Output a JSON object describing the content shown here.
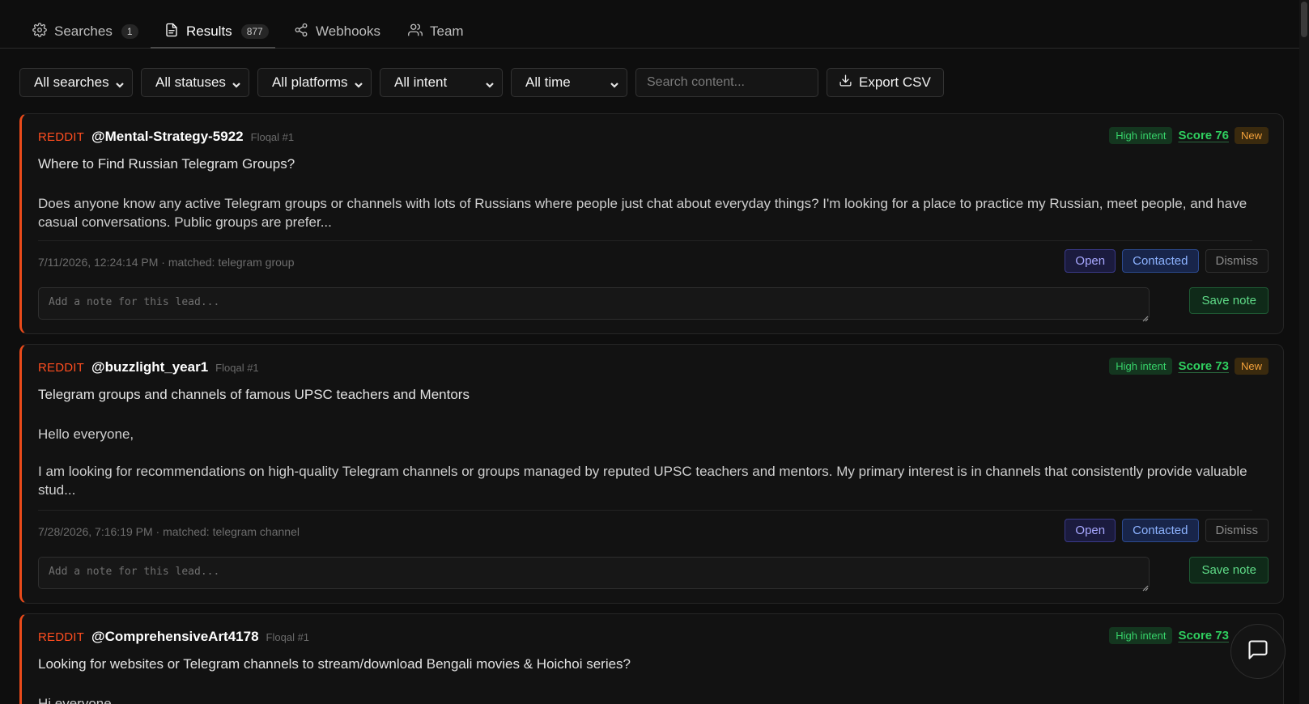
{
  "tabs": [
    {
      "label": "Searches",
      "count": "1",
      "icon": "gear-icon"
    },
    {
      "label": "Results",
      "count": "877",
      "icon": "document-icon"
    },
    {
      "label": "Webhooks",
      "icon": "share-nodes-icon"
    },
    {
      "label": "Team",
      "icon": "users-icon"
    }
  ],
  "active_tab": "Results",
  "filters": {
    "searches": "All searches",
    "statuses": "All statuses",
    "platforms": "All platforms",
    "intent": "All intent",
    "time": "All time",
    "search_placeholder": "Search content...",
    "export_label": "Export CSV"
  },
  "results": [
    {
      "platform": "REDDIT",
      "author": "@Mental-Strategy-5922",
      "search_ref": "Floqal #1",
      "intent": "High intent",
      "score": "Score 76",
      "status": "New",
      "title": "Where to Find Russian Telegram Groups?",
      "body": "Does anyone know any active Telegram groups or channels with lots of Russians where people just chat about everyday things? I'm looking for a place to practice my Russian, meet people, and have casual conversations. Public groups are prefer...",
      "meta": "7/11/2026, 12:24:14 PM · matched: telegram group",
      "note_placeholder": "Add a note for this lead..."
    },
    {
      "platform": "REDDIT",
      "author": "@buzzlight_year1",
      "search_ref": "Floqal #1",
      "intent": "High intent",
      "score": "Score 73",
      "status": "New",
      "title": "Telegram groups and channels of famous UPSC teachers and Mentors",
      "body": "Hello everyone,\n\nI am looking for recommendations on high-quality Telegram channels or groups managed by reputed UPSC teachers and mentors. My primary interest is in channels that consistently provide valuable stud...",
      "meta": "7/28/2026, 7:16:19 PM · matched: telegram channel",
      "note_placeholder": "Add a note for this lead..."
    },
    {
      "platform": "REDDIT",
      "author": "@ComprehensiveArt4178",
      "search_ref": "Floqal #1",
      "intent": "High intent",
      "score": "Score 73",
      "title": "Looking for websites or Telegram channels to stream/download Bengali movies & Hoichoi series?",
      "body": "Hi everyone,"
    }
  ],
  "actions": {
    "open": "Open",
    "contacted": "Contacted",
    "dismiss": "Dismiss",
    "save_note": "Save note"
  },
  "colors": {
    "platform": "#ff4d1f",
    "intent": "#37d36a",
    "new": "#f3a13a",
    "accent_border": "#ea4a1a"
  }
}
